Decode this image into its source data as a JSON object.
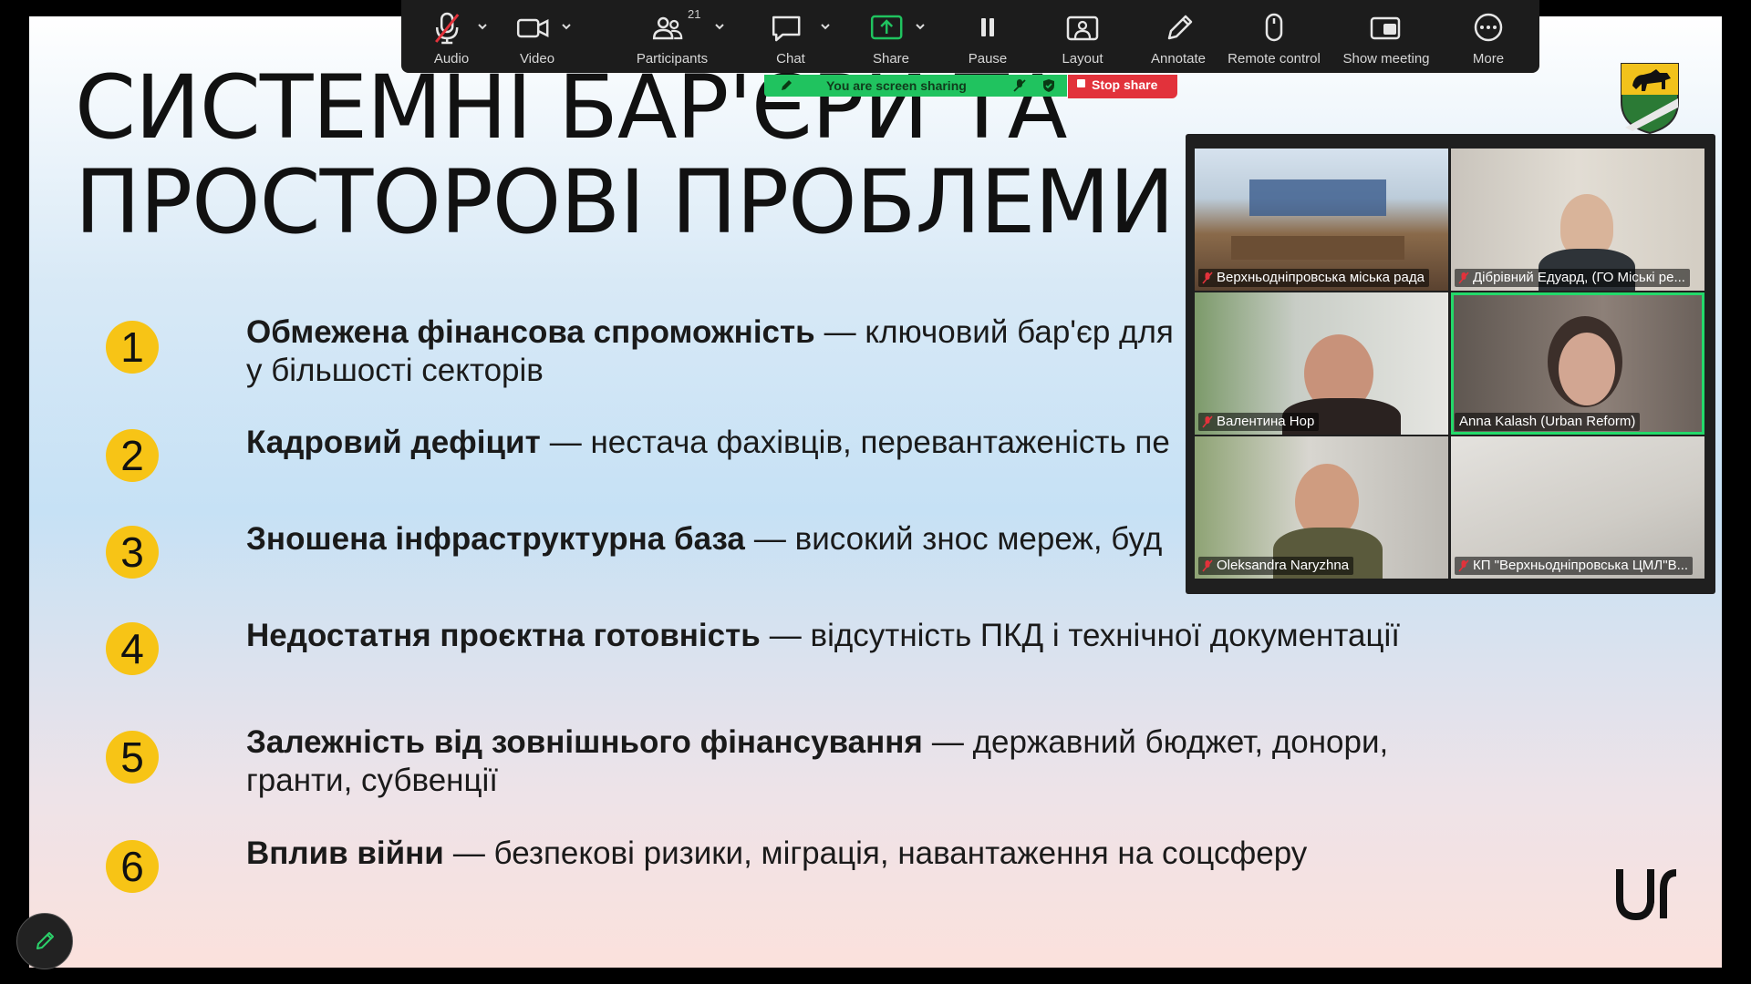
{
  "slide": {
    "title_line1": "СИСТЕМНІ БАР'ЄРИ ТА",
    "title_line2": "ПРОСТОРОВІ ПРОБЛЕМИ",
    "items": [
      {
        "num": "1",
        "bold": "Обмежена фінансова спроможність",
        "rest": "— ключовий бар'єр для",
        "line2": "у більшості секторів"
      },
      {
        "num": "2",
        "bold": "Кадровий дефіцит",
        "rest": "— нестача фахівців, перевантаженість пе",
        "line2": ""
      },
      {
        "num": "3",
        "bold": "Зношена інфраструктурна база",
        "rest": "— високий знос мереж, буд",
        "line2": ""
      },
      {
        "num": "4",
        "bold": "Недостатня проєктна готовність",
        "rest": "— відсутність ПКД і технічної документації",
        "line2": ""
      },
      {
        "num": "5",
        "bold": "Залежність від зовнішнього фінансування",
        "rest": "— державний бюджет, донори,",
        "line2": "гранти, субвенції"
      },
      {
        "num": "6",
        "bold": "Вплив війни",
        "rest": "— безпекові ризики, міграція, навантаження на соцсферу",
        "line2": ""
      }
    ]
  },
  "toolbar": {
    "audio": "Audio",
    "video": "Video",
    "participants": "Participants",
    "participants_count": "21",
    "chat": "Chat",
    "share": "Share",
    "pause": "Pause",
    "layout": "Layout",
    "annotate": "Annotate",
    "remote_control": "Remote control",
    "show_meeting": "Show meeting",
    "more": "More"
  },
  "sharing": {
    "banner": "You are screen sharing",
    "stop": "Stop share"
  },
  "gallery": {
    "participants": [
      {
        "name": "Верхньодніпровська міська рада",
        "muted": true
      },
      {
        "name": "Дібрівний Едуард, (ГО Міські ре...",
        "muted": true
      },
      {
        "name": "Валентина Нор",
        "muted": true
      },
      {
        "name": "Anna Kalash (Urban Reform)",
        "muted": false
      },
      {
        "name": "Oleksandra Naryzhna",
        "muted": true
      },
      {
        "name": "КП \"Верхньодніпровська ЦМЛ\"В...",
        "muted": true
      }
    ]
  },
  "colors": {
    "badge_yellow": "#f7c416",
    "active_speaker": "#23d96a",
    "share_green": "#20c35f",
    "stop_red": "#e2323b",
    "toolbar_bg": "#1c1c1c"
  },
  "icons": [
    "mic-muted-icon",
    "video-camera-icon",
    "participants-icon",
    "chat-bubble-icon",
    "share-screen-icon",
    "pause-icon",
    "layout-icon",
    "annotate-pen-icon",
    "remote-control-mouse-icon",
    "show-meeting-icon",
    "more-dots-icon",
    "pencil-icon"
  ]
}
